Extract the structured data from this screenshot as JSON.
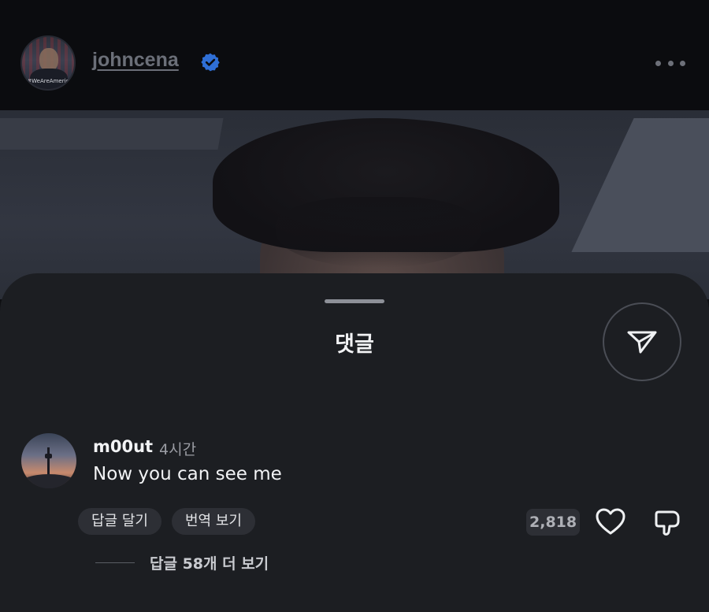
{
  "header": {
    "username": "johncena",
    "avatar_caption": "#WeAreAmerica",
    "verified_icon": "verified-badge-icon",
    "more_icon": "more-horizontal-icon"
  },
  "sheet": {
    "title": "댓글",
    "share_icon": "send-icon"
  },
  "comment": {
    "user": "m00ut",
    "time": "4시간",
    "text": "Now you can see me",
    "reply_label": "답글 달기",
    "translate_label": "번역 보기",
    "likes": "2,818",
    "like_icon": "heart-icon",
    "dislike_icon": "dislike-icon",
    "view_replies": "답글 58개 더 보기"
  },
  "colors": {
    "background": "#0e0f12",
    "sheet": "#1c1e22",
    "chip": "#2d2f35",
    "verified": "#3b82f6"
  }
}
